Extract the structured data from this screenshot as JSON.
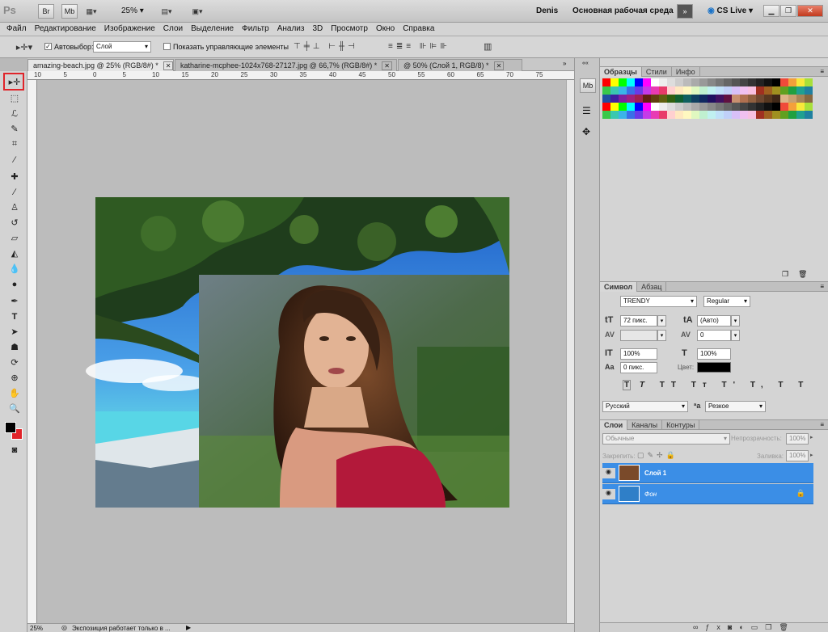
{
  "app": {
    "user": "Denis",
    "workspace": "Основная рабочая среда",
    "cs_live": "CS Live",
    "zoom": "25%"
  },
  "menu": [
    "Файл",
    "Редактирование",
    "Изображение",
    "Слои",
    "Выделение",
    "Фильтр",
    "Анализ",
    "3D",
    "Просмотр",
    "Окно",
    "Справка"
  ],
  "options": {
    "autoselect_label": "Автовыбор:",
    "autoselect_value": "Слой",
    "show_controls": "Показать управляющие элементы"
  },
  "tabs": [
    {
      "label": "amazing-beach.jpg @ 25% (RGB/8#) *",
      "active": true
    },
    {
      "label": "katharine-mcphee-1024x768-27127.jpg @ 66,7% (RGB/8#) *",
      "active": false
    },
    {
      "label": "@ 50% (Слой 1, RGB/8) *",
      "active": false
    }
  ],
  "ruler_numbers": [
    "10",
    "5",
    "0",
    "5",
    "10",
    "15",
    "20",
    "25",
    "30",
    "35",
    "40",
    "45",
    "50",
    "55",
    "60",
    "65",
    "70",
    "75"
  ],
  "panels": {
    "swatch_tabs": [
      "Образцы",
      "Стили",
      "Инфо"
    ],
    "char_tabs": [
      "Символ",
      "Абзац"
    ],
    "font_family": "TRENDY",
    "font_style": "Regular",
    "font_size": "72 пикс.",
    "leading": "(Авто)",
    "kerning": "",
    "tracking": "0",
    "vscale": "100%",
    "hscale": "100%",
    "baseline": "0 пикс.",
    "color_label": "Цвет:",
    "language": "Русский",
    "antialias": "Резкое",
    "layer_tabs": [
      "Слои",
      "Каналы",
      "Контуры"
    ],
    "blend_mode": "Обычные",
    "opacity_label": "Непрозрачность:",
    "opacity": "100%",
    "lock_label": "Закрепить:",
    "fill_label": "Заливка:",
    "fill": "100%",
    "layers": [
      {
        "name": "Слой 1"
      },
      {
        "name": "Фон"
      }
    ]
  },
  "status": {
    "zoom": "25%",
    "text": "Экспозиция работает только в ..."
  },
  "colors": {
    "accent": "#3b8ee6",
    "selected_tool": "#e0242a"
  }
}
